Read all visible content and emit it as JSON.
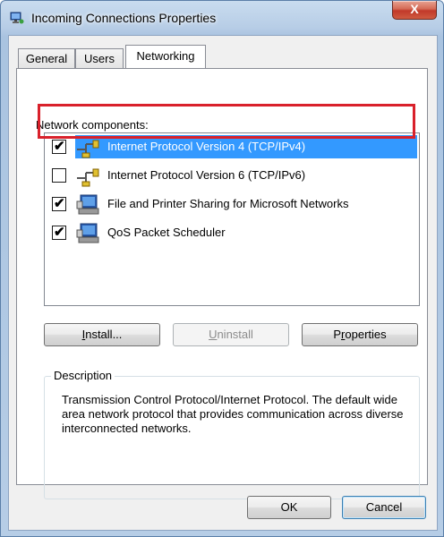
{
  "window": {
    "title": "Incoming Connections Properties",
    "close_label": "X"
  },
  "tabs": [
    {
      "label": "General",
      "active": false
    },
    {
      "label": "Users",
      "active": false
    },
    {
      "label": "Networking",
      "active": true
    }
  ],
  "network_components": {
    "label": "Network components:",
    "items": [
      {
        "label": "Internet Protocol Version 4 (TCP/IPv4)",
        "checked": true,
        "selected": true,
        "icon": "network-protocol-icon"
      },
      {
        "label": "Internet Protocol Version 6 (TCP/IPv6)",
        "checked": false,
        "selected": false,
        "icon": "network-protocol-icon"
      },
      {
        "label": "File and Printer Sharing for Microsoft Networks",
        "checked": true,
        "selected": false,
        "icon": "network-service-icon"
      },
      {
        "label": "QoS Packet Scheduler",
        "checked": true,
        "selected": false,
        "icon": "network-service-icon"
      }
    ]
  },
  "buttons": {
    "install": {
      "pre": "",
      "accel": "I",
      "post": "nstall..."
    },
    "uninstall": {
      "pre": "",
      "accel": "U",
      "post": "ninstall"
    },
    "properties": {
      "pre": "P",
      "accel": "r",
      "post": "operties"
    },
    "ok": "OK",
    "cancel": "Cancel"
  },
  "description": {
    "title": "Description",
    "text": "Transmission Control Protocol/Internet Protocol. The default wide area network protocol that provides communication across diverse interconnected networks."
  },
  "colors": {
    "selection": "#3399ff",
    "highlight_border": "#d9212b",
    "close_button": "#c1392a"
  }
}
